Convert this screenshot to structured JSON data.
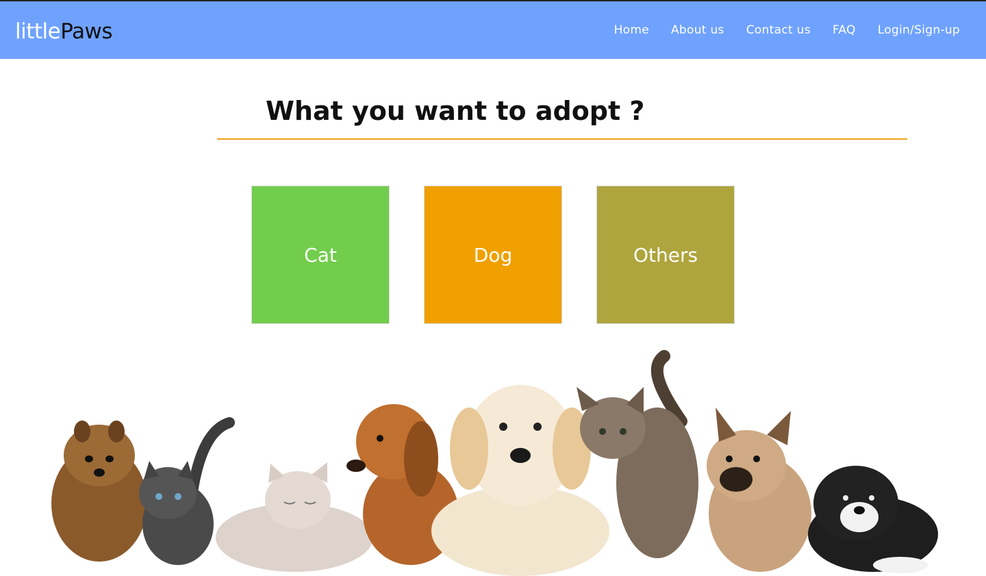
{
  "header": {
    "logo_light": "little",
    "logo_dark": "Paws",
    "nav": [
      {
        "label": "Home"
      },
      {
        "label": "About us"
      },
      {
        "label": "Contact us"
      },
      {
        "label": "FAQ"
      },
      {
        "label": "Login/Sign-up"
      }
    ],
    "bg_color": "#6fa2fe"
  },
  "main": {
    "heading": "What you want to adopt ?",
    "divider_color": "#efa21a",
    "options": [
      {
        "label": "Cat",
        "color": "#72cd4d"
      },
      {
        "label": "Dog",
        "color": "#f0a000"
      },
      {
        "label": "Others",
        "color": "#aea53e"
      }
    ]
  },
  "hero_image": {
    "icon": "puppies-and-kittens-illustration"
  }
}
